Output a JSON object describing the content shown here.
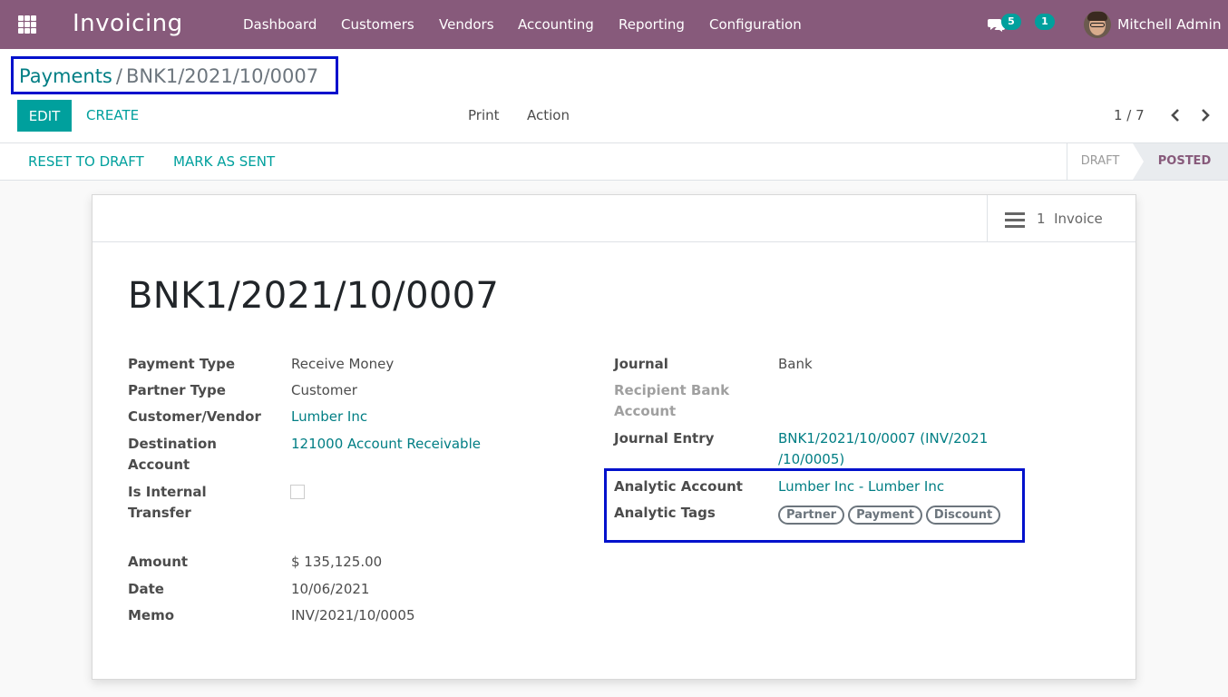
{
  "navbar": {
    "app_name": "Invoicing",
    "menu": [
      "Dashboard",
      "Customers",
      "Vendors",
      "Accounting",
      "Reporting",
      "Configuration"
    ],
    "messages_count": "5",
    "activities_count": "1",
    "user_name": "Mitchell Admin",
    "bg_color": "#875a7b"
  },
  "breadcrumb": {
    "parent": "Payments",
    "separator": "/",
    "current": "BNK1/2021/10/0007"
  },
  "toolbar": {
    "edit_label": "EDIT",
    "create_label": "CREATE",
    "print_label": "Print",
    "action_label": "Action"
  },
  "pager": {
    "value": "1 / 7"
  },
  "statusbar": {
    "reset_label": "RESET TO DRAFT",
    "mark_sent_label": "MARK AS SENT",
    "stages": [
      "DRAFT",
      "POSTED"
    ],
    "active_stage": "POSTED"
  },
  "smart_button": {
    "count": "1",
    "label": "Invoice",
    "icon": "list-icon"
  },
  "record": {
    "title": "BNK1/2021/10/0007",
    "left_fields": {
      "payment_type": {
        "label": "Payment Type",
        "value": "Receive Money"
      },
      "partner_type": {
        "label": "Partner Type",
        "value": "Customer"
      },
      "customer_vendor": {
        "label": "Customer/Vendor",
        "value": "Lumber Inc"
      },
      "destination_account": {
        "label_line1": "Destination",
        "label_line2": "Account",
        "value": "121000 Account Receivable"
      },
      "internal_transfer": {
        "label_line1": "Is Internal",
        "label_line2": "Transfer",
        "checked": false
      },
      "amount": {
        "label": "Amount",
        "value": "$ 135,125.00"
      },
      "date": {
        "label": "Date",
        "value": "10/06/2021"
      },
      "memo": {
        "label": "Memo",
        "value": "INV/2021/10/0005"
      }
    },
    "right_fields": {
      "journal": {
        "label": "Journal",
        "value": "Bank"
      },
      "recipient_bank": {
        "label_line1": "Recipient Bank",
        "label_line2": "Account"
      },
      "journal_entry": {
        "label": "Journal Entry",
        "value_line1": "BNK1/2021/10/0007 (INV/2021",
        "value_line2": "/10/0005)"
      },
      "analytic_account": {
        "label": "Analytic Account",
        "value": "Lumber Inc - Lumber Inc"
      },
      "analytic_tags": {
        "label": "Analytic Tags",
        "tags": [
          "Partner",
          "Payment",
          "Discount"
        ]
      }
    }
  },
  "colors": {
    "primary": "#00a09d",
    "link": "#017e84",
    "highlight_border": "#0011cc"
  }
}
